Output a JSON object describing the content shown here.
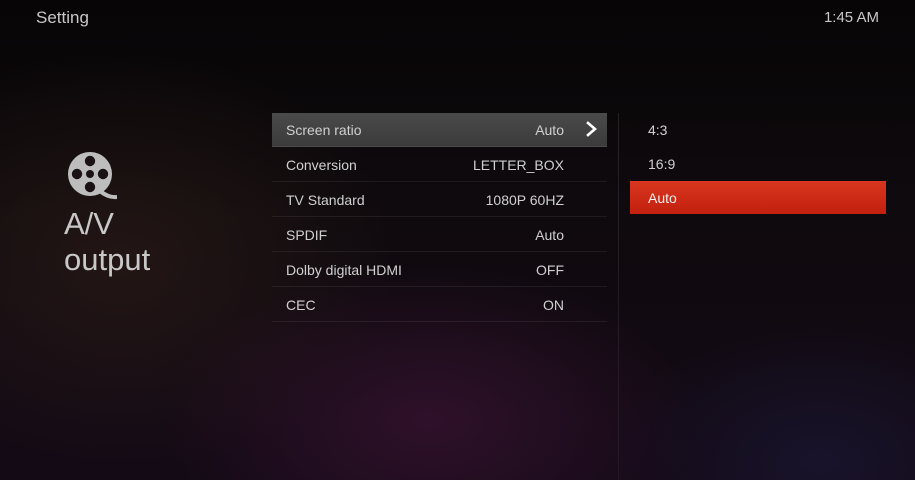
{
  "header": {
    "title": "Setting",
    "time": "1:45 AM"
  },
  "section": {
    "icon": "film-reel-icon",
    "title": "A/V\noutput"
  },
  "menu": {
    "items": [
      {
        "label": "Screen ratio",
        "value": "Auto",
        "selected": true
      },
      {
        "label": "Conversion",
        "value": "LETTER_BOX",
        "selected": false
      },
      {
        "label": "TV Standard",
        "value": "1080P 60HZ",
        "selected": false
      },
      {
        "label": "SPDIF",
        "value": "Auto",
        "selected": false
      },
      {
        "label": "Dolby digital HDMI",
        "value": "OFF",
        "selected": false
      },
      {
        "label": "CEC",
        "value": "ON",
        "selected": false
      }
    ]
  },
  "options": {
    "items": [
      {
        "label": "4:3",
        "selected": false
      },
      {
        "label": "16:9",
        "selected": false
      },
      {
        "label": "Auto",
        "selected": true
      }
    ]
  },
  "colors": {
    "selected_option": "#d02c18",
    "selected_menu_row": "#444444"
  }
}
